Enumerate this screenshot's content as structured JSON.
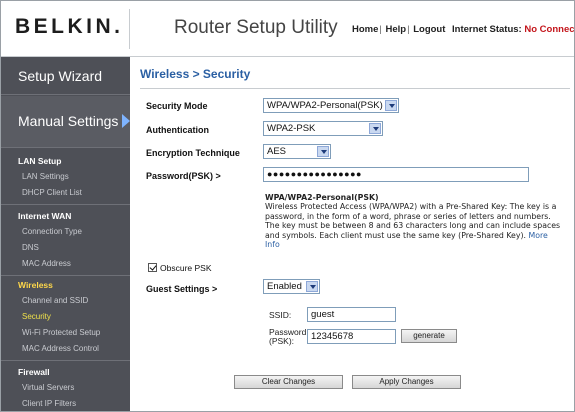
{
  "header": {
    "logo": "BELKIN.",
    "title": "Router Setup Utility",
    "links": [
      "Home",
      "Help",
      "Logout"
    ],
    "internet_status_label": "Internet Status:",
    "internet_status_value": "No Connection",
    "status_color": "#c4161c"
  },
  "sidebar": {
    "setup_wizard": "Setup Wizard",
    "manual_settings": "Manual Settings",
    "groups": [
      {
        "title": "LAN Setup",
        "items": [
          "LAN Settings",
          "DHCP Client List"
        ]
      },
      {
        "title": "Internet WAN",
        "items": [
          "Connection Type",
          "DNS",
          "MAC Address"
        ]
      },
      {
        "title": "Wireless",
        "items": [
          "Channel and SSID",
          "Security",
          "Wi-Fi Protected Setup",
          "MAC Address Control"
        ]
      },
      {
        "title": "Firewall",
        "items": [
          "Virtual Servers",
          "Client IP Filters"
        ]
      }
    ],
    "active_group": "Wireless",
    "current_item": "Security"
  },
  "main": {
    "breadcrumb": "Wireless > Security",
    "security_mode": {
      "label": "Security Mode",
      "value": "WPA/WPA2-Personal(PSK)"
    },
    "authentication": {
      "label": "Authentication",
      "value": "WPA2-PSK"
    },
    "encryption": {
      "label": "Encryption Technique",
      "value": "AES"
    },
    "password": {
      "label": "Password(PSK) >",
      "value": "●●●●●●●●●●●●●●●●"
    },
    "description": {
      "title": "WPA/WPA2-Personal(PSK)",
      "body": "Wireless Protected Access (WPA/WPA2) with a Pre-Shared Key: The key is a password, in the form of a word, phrase or series of letters and numbers. The key must be between 8 and 63 characters long and can include spaces and symbols. Each client must use the same key (Pre-Shared Key).",
      "more_info": "More Info"
    },
    "obscure_psk": {
      "label": "Obscure PSK",
      "checked": true
    },
    "guest": {
      "label": "Guest Settings >",
      "value": "Enabled",
      "ssid_label": "SSID:",
      "ssid_value": "guest",
      "password_label_1": "Password",
      "password_label_2": "(PSK):",
      "password_value": "12345678",
      "generate": "generate"
    },
    "buttons": {
      "clear": "Clear Changes",
      "apply": "Apply Changes"
    }
  },
  "colors": {
    "accent": "#2a5fa3",
    "sidebar_bg": "#4e5057",
    "highlight": "#ffd84a"
  }
}
